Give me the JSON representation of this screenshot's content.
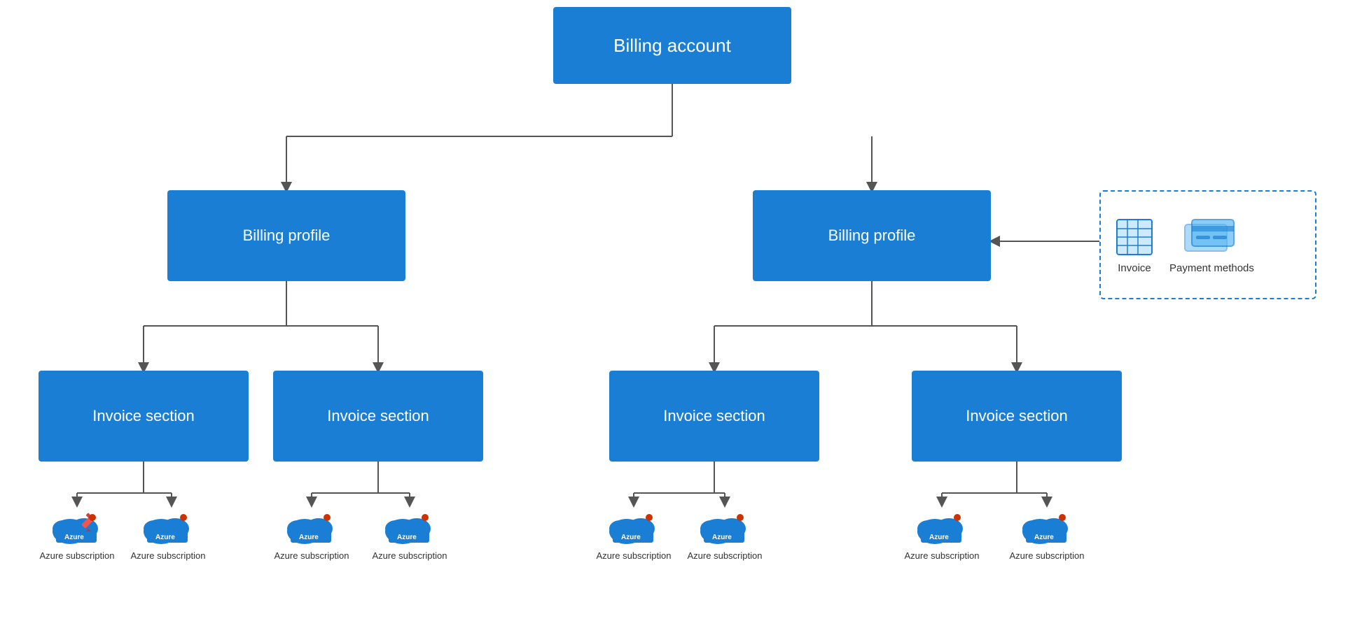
{
  "nodes": {
    "billing_account": {
      "label": "Billing account"
    },
    "billing_profile_left": {
      "label": "Billing profile"
    },
    "billing_profile_right": {
      "label": "Billing profile"
    },
    "invoice_sections": [
      {
        "label": "Invoice section"
      },
      {
        "label": "Invoice section"
      },
      {
        "label": "Invoice section"
      },
      {
        "label": "Invoice section"
      }
    ]
  },
  "azure_subscriptions": {
    "label": "Azure subscription",
    "count": 8
  },
  "side_box": {
    "invoice_label": "Invoice",
    "payment_label": "Payment methods"
  },
  "colors": {
    "blue": "#1a7fd4",
    "light_blue": "#5bb8f5",
    "arrow": "#555555",
    "dashed_border": "#1a7fd4"
  }
}
